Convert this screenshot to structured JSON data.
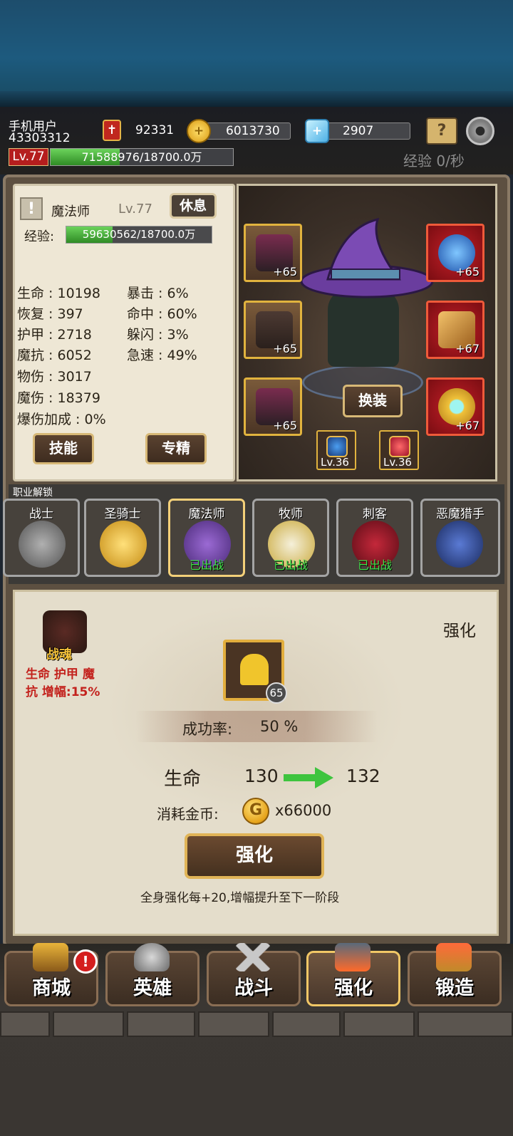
{
  "header": {
    "user_name": "手机用户",
    "user_id": "43303312",
    "power": "92331",
    "gold": "6013730",
    "gems": "2907",
    "level": "Lv.77",
    "exp_text": "71588976/18700.0万",
    "exp_fraction": 0.38,
    "exp_rate": "经验 0/秒"
  },
  "hero": {
    "class_name": "魔法师",
    "level": "Lv.77",
    "rest_label": "休息",
    "exp_label": "经验:",
    "exp_text": "59630562/18700.0万",
    "exp_fraction": 0.32,
    "stats_left": [
      "生命 : 10198",
      "恢复 : 397",
      "护甲 : 2718",
      "魔抗 : 6052",
      "物伤 : 3017",
      "魔伤 : 18379",
      "爆伤加成 : 0%"
    ],
    "stats_right": [
      "暴击 : 6%",
      "命中 : 60%",
      "躲闪 : 3%",
      "急速 : 49%"
    ],
    "skill_label": "技能",
    "mastery_label": "专精"
  },
  "equipment": {
    "slots_left": [
      "+65",
      "+65",
      "+65"
    ],
    "slots_right": [
      "+65",
      "+67",
      "+67"
    ],
    "small_slots": [
      "Lv.36",
      "Lv.36"
    ],
    "swap_label": "换装"
  },
  "classes": {
    "title": "职业解锁",
    "items": [
      {
        "name": "战士",
        "status": ""
      },
      {
        "name": "圣骑士",
        "status": ""
      },
      {
        "name": "魔法师",
        "status": "已出战"
      },
      {
        "name": "牧师",
        "status": "已出战"
      },
      {
        "name": "刺客",
        "status": "已出战"
      },
      {
        "name": "恶魔猎手",
        "status": ""
      }
    ]
  },
  "enhance": {
    "soul_name": "战魂",
    "soul_desc_line1": "生命 护甲 魔",
    "soul_desc_line2": "抗 增幅:15%",
    "title": "强化",
    "item_level": "65",
    "success_label": "成功率:",
    "success_value": "50 %",
    "attr_name": "生命",
    "attr_from": "130",
    "attr_to": "132",
    "cost_label": "消耗金币:",
    "cost_value": "x66000",
    "button_label": "强化",
    "note": "全身强化每+20,增幅提升至下一阶段"
  },
  "nav": {
    "items": [
      "商城",
      "英雄",
      "战斗",
      "强化",
      "锻造"
    ],
    "badge": "!"
  },
  "icons": {
    "power": "sword-shield-icon",
    "gold": "gold-plus-icon",
    "gems": "gem-plus-icon",
    "settings": "gear-icon",
    "help": "book-question-icon"
  }
}
